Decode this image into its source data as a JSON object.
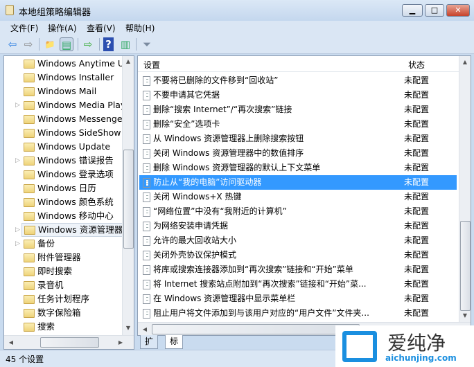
{
  "window": {
    "title": "本地组策略编辑器",
    "minimize": "▁",
    "maximize": "□",
    "close": "✕"
  },
  "menu": [
    "文件(F)",
    "操作(A)",
    "查看(V)",
    "帮助(H)"
  ],
  "toolbar": {
    "back": "⇦",
    "forward": "⇨",
    "up": "📁",
    "showhide": "▤",
    "export": "⇨",
    "help": "?",
    "properties": "▥",
    "filter": "⏷"
  },
  "tree": [
    {
      "label": "Windows Anytime Up",
      "expandable": false
    },
    {
      "label": "Windows Installer",
      "expandable": false
    },
    {
      "label": "Windows Mail",
      "expandable": false
    },
    {
      "label": "Windows Media Playe",
      "expandable": true
    },
    {
      "label": "Windows Messenger",
      "expandable": false
    },
    {
      "label": "Windows SideShow",
      "expandable": false
    },
    {
      "label": "Windows Update",
      "expandable": false
    },
    {
      "label": "Windows 错误报告",
      "expandable": true
    },
    {
      "label": "Windows 登录选项",
      "expandable": false
    },
    {
      "label": "Windows 日历",
      "expandable": false
    },
    {
      "label": "Windows 颜色系统",
      "expandable": false
    },
    {
      "label": "Windows 移动中心",
      "expandable": false
    },
    {
      "label": "Windows 资源管理器",
      "expandable": true,
      "selected": true
    },
    {
      "label": "备份",
      "expandable": true
    },
    {
      "label": "附件管理器",
      "expandable": false
    },
    {
      "label": "即时搜索",
      "expandable": false
    },
    {
      "label": "录音机",
      "expandable": false
    },
    {
      "label": "任务计划程序",
      "expandable": false
    },
    {
      "label": "数字保险箱",
      "expandable": false
    },
    {
      "label": "搜索",
      "expandable": false
    }
  ],
  "list": {
    "col_setting": "设置",
    "col_state": "状态",
    "rows": [
      {
        "name": "不要将已删除的文件移到“回收站”",
        "state": "未配置"
      },
      {
        "name": "不要申请其它凭据",
        "state": "未配置"
      },
      {
        "name": "删除“搜索 Internet”/“再次搜索”链接",
        "state": "未配置"
      },
      {
        "name": "删除“安全”选项卡",
        "state": "未配置"
      },
      {
        "name": "从 Windows 资源管理器上删除搜索按钮",
        "state": "未配置"
      },
      {
        "name": "关闭 Windows 资源管理器中的数值排序",
        "state": "未配置"
      },
      {
        "name": "删除 Windows 资源管理器的默认上下文菜单",
        "state": "未配置"
      },
      {
        "name": "防止从“我的电脑”访问驱动器",
        "state": "未配置",
        "selected": true
      },
      {
        "name": "关闭 Windows+X 热键",
        "state": "未配置"
      },
      {
        "name": "“网络位置”中没有“我附近的计算机”",
        "state": "未配置"
      },
      {
        "name": "为网络安装申请凭据",
        "state": "未配置"
      },
      {
        "name": "允许的最大回收站大小",
        "state": "未配置"
      },
      {
        "name": "关闭外壳协议保护模式",
        "state": "未配置"
      },
      {
        "name": "将库或搜索连接器添加到“再次搜索”链接和“开始”菜单",
        "state": "未配置"
      },
      {
        "name": "将 Internet 搜索站点附加到“再次搜索”链接和“开始”菜...",
        "state": "未配置"
      },
      {
        "name": "在 Windows 资源管理器中显示菜单栏",
        "state": "未配置"
      },
      {
        "name": "阻止用户将文件添加到与该用户对应的“用户文件”文件夹...",
        "state": "未配置"
      }
    ]
  },
  "tabs": [
    "扩展",
    "标准"
  ],
  "status": "45 个设置",
  "watermark": {
    "name": "爱纯净",
    "url": "aichunjing.com"
  }
}
